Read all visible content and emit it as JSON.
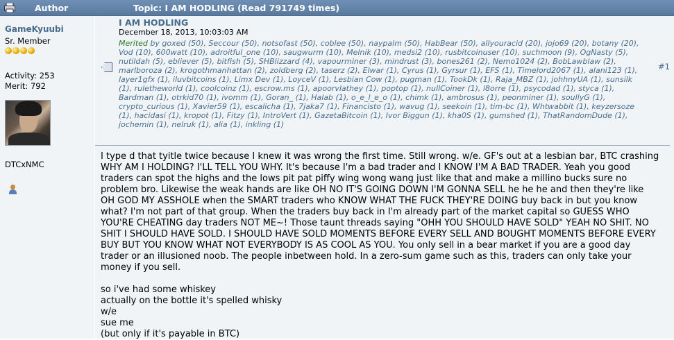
{
  "header": {
    "author_label": "Author",
    "topic_label": "Topic: I AM HODLING  (Read 791749 times)"
  },
  "poster": {
    "name": "GameKyuubi",
    "rank": "Sr. Member",
    "activity": "Activity: 253",
    "merit": "Merit: 792",
    "personal_text": "DTCxNMC"
  },
  "post": {
    "title": "I AM HODLING",
    "date": "December 18, 2013, 10:03:03 AM",
    "merited_prefix": "Merited",
    "merited_by": "by goxed (50), Seccour (50), notsofast (50), coblee (50), naypalm (50), HabBear (50), allyouracid (20), jojo69 (20), botany (20), Vod (10), 600watt (10), adroitful_one (10), saugwurm (10), Melnik (10), medsi2 (10), rusbitcoinuser (10), suchmoon (9), OgNasty (5), nutildah (5), ebliever (5), bitfish (5), SHBlizzard (4), vapourminer (3), mindrust (3), bones261 (2), Nemo1024 (2), BobLawblaw (2), marlboroza (2), krogothmanhattan (2), zoldberg (2), taserz (2), Elwar (1), Cyrus (1), Gyrsur (1), EFS (1), Timelord2067 (1), alani123 (1), layer1gfx (1), iluvbitcoins (1), Limx Dev (1), LoyceV (1), Lesbian Cow (1), pugman (1), TookDk (1), Raja_MBZ (1), johhnyUA (1), sunsilk (1), ruletheworld (1), coolcoinz (1), escrow.ms (1), apoorvlathey (1), poptop (1), nullCoiner (1), l8orre (1), psycodad (1), styca (1), Bardman (1), otrkid70 (1), ivomm (1), Goran_ (1), Halab (1), o_e_l_e_o (1), chimk (1), ambrosus (1), peonminer (1), soullyG (1), crypto_curious (1), Xavier59 (1), escalicha (1), 7jaka7 (1), Financisto (1), wavug (1), seekoin (1), tim-bc (1), Whtwabbit (1), keyzersoze (1), hacidasi (1), kropot (1), Fitzy (1), IntroVert (1), GazetaBitcoin (1), Ivor Biggun (1), kha0S (1), gumshed (1), ThatRandomDude (1), jochemin (1), nelruk (1), alia (1), inkling (1)",
    "number": "#1",
    "paragraph_1": "I type d that tyitle twice because I knew it was wrong the first time.  Still wrong.  w/e.  GF's out at a lesbian bar, BTC crashing WHY AM I HOLDING? I'LL TELL YOU WHY.  It's because I'm a bad trader and I KNOW I'M A BAD TRADER.  Yeah you good traders can spot the highs and the lows pit pat piffy wing wong wang just like that and make a millino bucks sure no problem bro.  Likewise the weak hands are like OH NO IT'S GOING DOWN I'M GONNA SELL he he he and then they're like OH GOD MY ASSHOLE when the SMART traders who KNOW WHAT THE FUCK THEY'RE DOING buy back in but you know what?  I'm not part of that group.  When the traders buy back in I'm already part of the market capital so GUESS WHO YOU'RE CHEATING day traders NOT ME~!  Those taunt threads saying \"OHH YOU SHOULD HAVE SOLD\" YEAH NO SHIT.  NO SHIT I SHOULD HAVE SOLD.  I SHOULD HAVE SOLD MOMENTS BEFORE EVERY SELL AND BOUGHT MOMENTS BEFORE EVERY BUY BUT YOU KNOW WHAT NOT EVERYBODY IS AS COOL AS YOU.  You only sell in a bear market if you are a good day trader or an illusioned noob.  The people inbetween hold.  In a zero-sum game such as this, traders can only take your money if you sell.",
    "line_1": "so i've had some whiskey",
    "line_2": "actually on the bottle it's spelled whisky",
    "line_3": "w/e",
    "line_4": "sue me",
    "line_5": "(but only if it's payable in BTC)"
  },
  "icons": [
    "printer-icon",
    "star-icon",
    "avatar",
    "profile-icon",
    "post-tag-icon"
  ]
}
